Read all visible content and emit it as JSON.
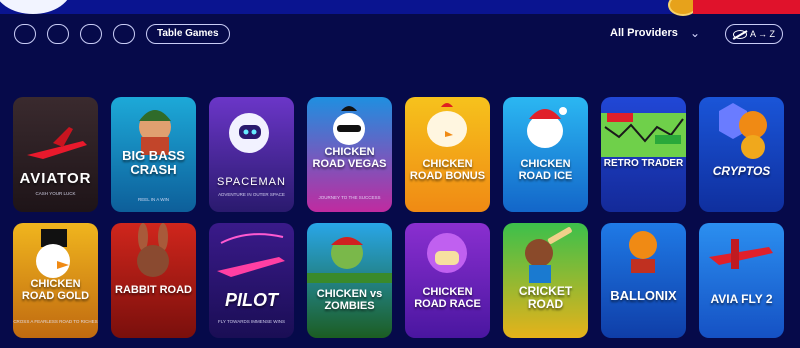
{
  "filters": {
    "table_games": "Table Games",
    "providers": "All Providers",
    "sort": "A → Z"
  },
  "games": [
    {
      "title": "AVIATOR",
      "subtitle": "cash your luck",
      "bg": "linear-gradient(180deg,#3a2a2e,#1e1418)"
    },
    {
      "title": "BIG BASS CRASH",
      "subtitle": "reel in a win",
      "bg": "linear-gradient(180deg,#1da9d8,#0d5f9a)"
    },
    {
      "title": "SPACEMAN",
      "subtitle": "adventure in outer space",
      "bg": "linear-gradient(180deg,#6b36c8,#2a1a6e)"
    },
    {
      "title": "CHICKEN ROAD VEGAS",
      "subtitle": "journey to the success",
      "bg": "linear-gradient(180deg,#1f8fe0,#c02ba0)"
    },
    {
      "title": "CHICKEN ROAD BONUS",
      "subtitle": "",
      "bg": "linear-gradient(180deg,#f6c21c,#f08a14)"
    },
    {
      "title": "CHICKEN ROAD ICE",
      "subtitle": "",
      "bg": "linear-gradient(180deg,#2bb7f2,#1366c9)"
    },
    {
      "title": "RETRO TRADER",
      "subtitle": "",
      "bg": "linear-gradient(180deg,#2147d6,#142a99)"
    },
    {
      "title": "CRYPTOS",
      "subtitle": "",
      "bg": "linear-gradient(180deg,#1a55d8,#0f2f9e)"
    },
    {
      "title": "CHICKEN ROAD GOLD",
      "subtitle": "cross a fearless road to riches",
      "bg": "linear-gradient(180deg,#f0b51e,#c06a10)"
    },
    {
      "title": "RABBIT ROAD",
      "subtitle": "",
      "bg": "linear-gradient(180deg,#d0261c,#7a0f0c)"
    },
    {
      "title": "PILOT",
      "subtitle": "fly towards immense wins",
      "bg": "linear-gradient(180deg,#3a1a8a,#1a0e55)"
    },
    {
      "title": "CHICKEN vs ZOMBIES",
      "subtitle": "",
      "bg": "linear-gradient(180deg,#29a6e8,#1c5d22)"
    },
    {
      "title": "CHICKEN ROAD RACE",
      "subtitle": "",
      "bg": "linear-gradient(180deg,#8a2fd0,#4a16a0)"
    },
    {
      "title": "CRICKET ROAD",
      "subtitle": "",
      "bg": "linear-gradient(180deg,#3cc04b,#e6b21a)"
    },
    {
      "title": "BALLONIX",
      "subtitle": "",
      "bg": "linear-gradient(180deg,#1f7ae6,#0f3ea8)"
    },
    {
      "title": "AVIA FLY 2",
      "subtitle": "",
      "bg": "linear-gradient(180deg,#2b8ff0,#1551c4)"
    }
  ]
}
